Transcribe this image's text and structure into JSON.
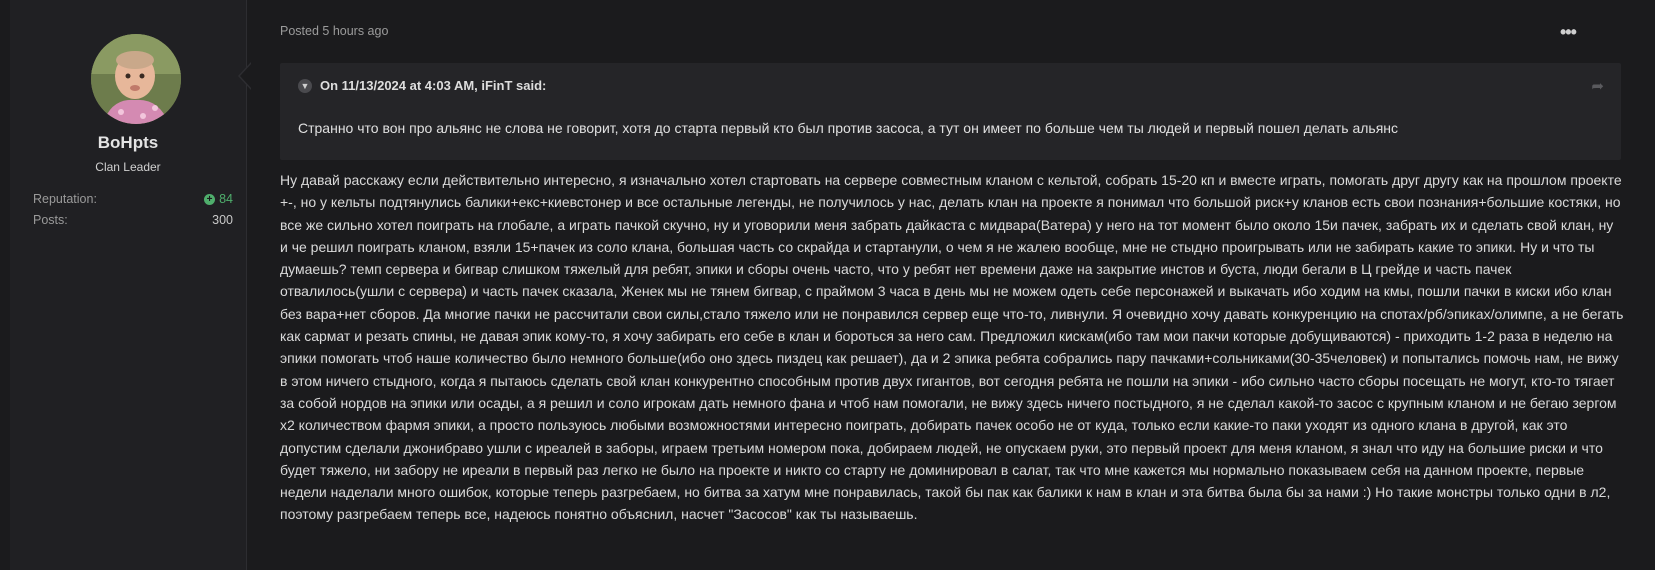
{
  "author": {
    "name": "BoHpts",
    "rank": "Clan Leader",
    "reputation_label": "Reputation:",
    "reputation_value": "84",
    "posts_label": "Posts:",
    "posts_value": "300"
  },
  "post": {
    "meta": "Posted 5 hours ago",
    "menu_icon": "ellipsis-icon",
    "quote": {
      "header": "On 11/13/2024 at 4:03 AM, iFinT said:",
      "text": "Странно что вон про альянс не слова не говорит, хотя до старта первый кто был против засоса, а тут он имеет по больше чем ты людей и первый пошел делать альянс"
    },
    "body": "Ну давай расскажу если действительно интересно, я изначально хотел стартовать на сервере совместным кланом с кельтой, собрать 15-20 кп и вместе играть, помогать друг другу как на прошлом проекте +-, но у кельты подтянулись балики+екс+киевстонер и все остальные легенды, не получилось у нас, делать клан на проекте я понимал что большой риск+у кланов есть свои познания+большие костяки, но все же сильно хотел поиграть на глобале, а играть пачкой скучно, ну и уговорили меня забрать дайкаста с мидвара(Ватера) у него на тот момент было около 15и пачек, забрать их и сделать свой клан, ну и че решил поиграть кланом, взяли 15+пачек из соло клана, большая часть со скрайда и стартанули, о чем я не жалею вообще, мне не стыдно проигрывать или не забирать какие то эпики. Ну и что ты думаешь? темп сервера и бигвар слишком тяжелый для ребят, эпики и сборы очень часто, что у ребят нет времени даже на закрытие инстов и буста, люди бегали в Ц грейде и часть пачек отвалилось(ушли с сервера) и часть пачек сказала, Женек мы не тянем бигвар, с  праймом 3 часа в день мы не можем одеть себе персонажей и выкачать ибо ходим на кмы, пошли пачки в киски ибо клан без вара+нет сборов. Да многие пачки не рассчитали свои силы,стало тяжело или не понравился сервер еще что-то, ливнули. Я очевидно хочу давать конкуренцию на спотах/рб/эпиках/олимпе, а не бегать как сармат и резать спины, не давая эпик кому-то, я хочу забирать его себе в клан и бороться за него сам. Предложил кискам(ибо там мои пакчи которые добущиваются) - приходить 1-2 раза в неделю на эпики помогать чтоб наше количество было немного больше(ибо оно здесь пиздец как решает), да и 2 эпика ребята собрались пару пачками+сольниками(30-35человек) и попытались помочь нам, не вижу в этом ничего стыдного, когда я пытаюсь сделать свой клан конкурентно способным против двух гигантов, вот сегодня ребята не пошли на эпики - ибо сильно часто сборы посещать не могут, кто-то тягает за собой нордов на эпики или осады, а я решил и соло игрокам дать немного фана и чтоб нам помогали, не вижу здесь ничего постыдного, я не сделал какой-то засос с крупным кланом и не бегаю зергом x2 количеством фармя эпики, а просто пользуюсь любыми возможностями интересно поиграть, добирать пачек особо не от куда, только если какие-то паки уходят из одного клана в другой, как это допустим сделали джонибраво ушли с иреалей в заборы, играем третьим номером пока, добираем людей, не опускаем руки, это первый проект для меня кланом, я знал что иду на большие риски и что будет тяжело, ни забору не иреали в первый раз легко не было на проекте и никто со старту не доминировал в салат, так что мне кажется мы нормально показываем себя на данном проекте, первые недели наделали много ошибок, которые теперь разгребаем, но битва за хатум мне понравилась, такой бы пак как балики к нам в клан и эта битва была бы за нами :) Но такие монстры только одни в л2, поэтому разгребаем теперь все, надеюсь понятно объяснил, насчет \"Засосов\" как ты называешь."
  },
  "colors": {
    "background": "#1b1b1d",
    "sidebar": "#202023",
    "quote_bg": "#252528",
    "reputation": "#4fae6c"
  }
}
